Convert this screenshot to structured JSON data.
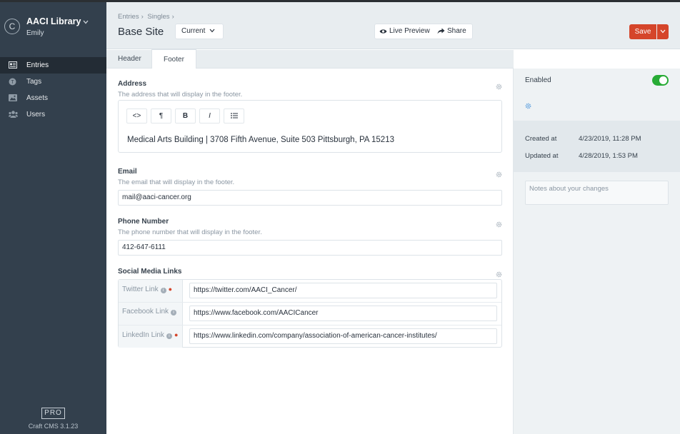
{
  "sidebar": {
    "site_initial": "C",
    "site_name": "AACI Library",
    "user_name": "Emily",
    "items": [
      {
        "label": "Entries",
        "icon": "entries-icon",
        "active": true
      },
      {
        "label": "Tags",
        "icon": "tag-icon",
        "active": false
      },
      {
        "label": "Assets",
        "icon": "image-icon",
        "active": false
      },
      {
        "label": "Users",
        "icon": "users-icon",
        "active": false
      }
    ],
    "edition_badge": "PRO",
    "cms_version": "Craft CMS 3.1.23"
  },
  "header": {
    "breadcrumbs": [
      "Entries",
      "Singles"
    ],
    "title": "Base Site",
    "site_select": "Current",
    "live_preview_label": "Live Preview",
    "share_label": "Share",
    "save_label": "Save"
  },
  "tabs": [
    {
      "label": "Header",
      "active": false
    },
    {
      "label": "Footer",
      "active": true
    }
  ],
  "fields": {
    "address": {
      "label": "Address",
      "instructions": "The address that will display in the footer.",
      "toolbar": [
        "<>",
        "¶",
        "B",
        "I",
        "list"
      ],
      "value": "Medical Arts Building | 3708 Fifth Avenue, Suite 503 Pittsburgh, PA 15213"
    },
    "email": {
      "label": "Email",
      "instructions": "The email that will display in the footer.",
      "value": "mail@aaci-cancer.org"
    },
    "phone": {
      "label": "Phone Number",
      "instructions": "The phone number that will display in the footer.",
      "value": "412-647-6111"
    },
    "social": {
      "label": "Social Media Links",
      "rows": [
        {
          "label": "Twitter Link",
          "value": "https://twitter.com/AACI_Cancer/"
        },
        {
          "label": "Facebook Link",
          "value": "https://www.facebook.com/AACICancer"
        },
        {
          "label": "LinkedIn Link",
          "value": "https://www.linkedin.com/company/association-of-american-cancer-institutes/"
        }
      ]
    }
  },
  "details": {
    "enabled_label": "Enabled",
    "enabled": true,
    "created_label": "Created at",
    "created_value": "4/23/2019, 11:28 PM",
    "updated_label": "Updated at",
    "updated_value": "4/28/2019, 1:53 PM",
    "notes_placeholder": "Notes about your changes"
  },
  "colors": {
    "sidebar_bg": "#33404d",
    "save_button": "#d5452a",
    "toggle_on": "#27ab35"
  }
}
